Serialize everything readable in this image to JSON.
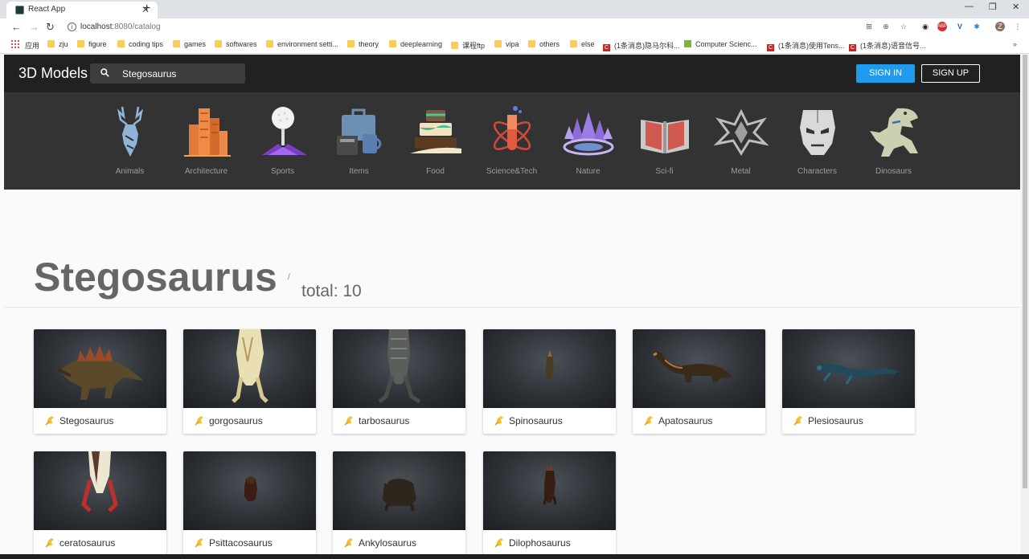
{
  "browser": {
    "tab_title": "React App",
    "url_host": "localhost",
    "url_path": ":8080/catalog",
    "bookmarks": [
      "应用",
      "zju",
      "figure",
      "coding tips",
      "games",
      "softwares",
      "environment setti...",
      "theory",
      "deeplearning",
      "课程ftp",
      "vipa",
      "others",
      "else",
      "(1条消息)隐马尔科...",
      "Computer Scienc...",
      "(1条消息)使用Tens...",
      "(1条消息)语音信号..."
    ]
  },
  "header": {
    "logo": "3D Models",
    "search_value": "Stegosaurus",
    "sign_in": "SIGN IN",
    "sign_up": "SIGN UP"
  },
  "categories": [
    {
      "label": "Animals",
      "icon": "deer-icon"
    },
    {
      "label": "Architecture",
      "icon": "buildings-icon"
    },
    {
      "label": "Sports",
      "icon": "golf-ball-icon"
    },
    {
      "label": "Items",
      "icon": "briefcase-icon"
    },
    {
      "label": "Food",
      "icon": "cake-icon"
    },
    {
      "label": "Science&Tech",
      "icon": "test-tube-icon"
    },
    {
      "label": "Nature",
      "icon": "forest-icon"
    },
    {
      "label": "Sci-fi",
      "icon": "book-icon"
    },
    {
      "label": "Metal",
      "icon": "metal-emblem-icon"
    },
    {
      "label": "Characters",
      "icon": "iron-mask-icon"
    },
    {
      "label": "Dinosaurs",
      "icon": "trex-icon"
    }
  ],
  "results": {
    "title": "Stegosaurus",
    "slash": "/",
    "total": "total: 10"
  },
  "models": [
    {
      "name": "Stegosaurus"
    },
    {
      "name": "gorgosaurus"
    },
    {
      "name": "tarbosaurus"
    },
    {
      "name": "Spinosaurus"
    },
    {
      "name": "Apatosaurus"
    },
    {
      "name": "Plesiosaurus"
    },
    {
      "name": "ceratosaurus"
    },
    {
      "name": "Psittacosaurus"
    },
    {
      "name": "Ankylosaurus"
    },
    {
      "name": "Dilophosaurus"
    }
  ],
  "colors": {
    "header_bg": "#212121",
    "category_bg": "#333333",
    "sign_in_bg": "#1e9bf0",
    "page_bg": "#fafafa"
  }
}
